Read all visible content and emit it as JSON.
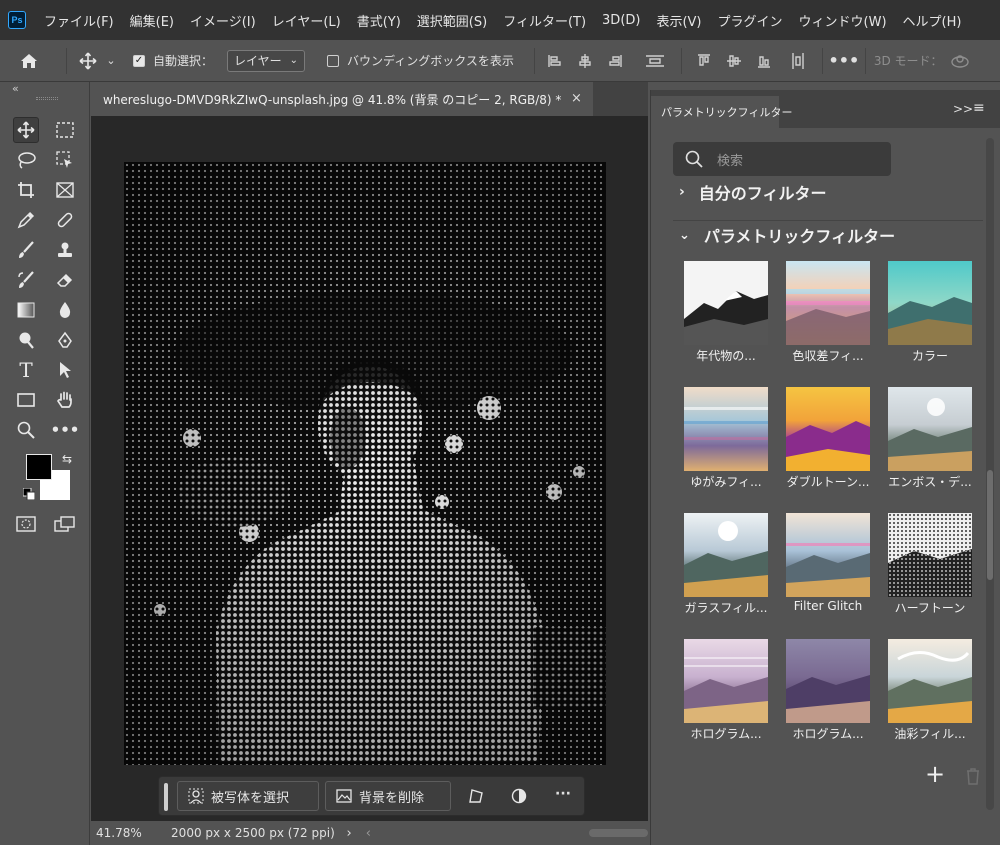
{
  "app": {
    "logo": "Ps"
  },
  "menubar": {
    "items": [
      "ファイル(F)",
      "編集(E)",
      "イメージ(I)",
      "レイヤー(L)",
      "書式(Y)",
      "選択範囲(S)",
      "フィルター(T)",
      "3D(D)",
      "表示(V)",
      "プラグイン",
      "ウィンドウ(W)",
      "ヘルプ(H)"
    ]
  },
  "options": {
    "auto_select_label": "自動選択：",
    "auto_select_checked": true,
    "target_value": "レイヤー",
    "bounding_box_label": "バウンディングボックスを表示",
    "bounding_box_checked": false,
    "mode_3d_label": "3D モード："
  },
  "toolbar": {
    "collapse": "«",
    "icons": [
      "move-tool-icon",
      "marquee-tool-icon",
      "lasso-tool-icon",
      "object-select-tool-icon",
      "crop-tool-icon",
      "frame-tool-icon",
      "eyedropper-tool-icon",
      "healing-brush-icon",
      "brush-tool-icon",
      "stamp-tool-icon",
      "history-brush-icon",
      "eraser-tool-icon",
      "gradient-tool-icon",
      "blur-tool-icon",
      "dodge-tool-icon",
      "pen-tool-icon",
      "type-tool-icon",
      "path-select-icon",
      "rectangle-tool-icon",
      "hand-tool-icon",
      "zoom-tool-icon",
      "more-tools-icon"
    ],
    "type_label": "T",
    "foreground": "#000000",
    "background": "#ffffff"
  },
  "document": {
    "tab_title": "whereslugo-DMVD9RkZIwQ-unsplash.jpg @ 41.8% (背景 のコピー 2, RGB/8) *",
    "close": "×"
  },
  "taskbar": {
    "select_subject": "被写体を選択",
    "remove_background": "背景を削除",
    "more": "···"
  },
  "status": {
    "zoom": "41.78%",
    "doc_info": "2000 px x 2500 px (72 ppi)",
    "arrow": "›",
    "left_arrow": "‹"
  },
  "panel": {
    "tab_title": "パラメトリックフィルター",
    "menu_glyphs": ">>",
    "search_placeholder": "検索",
    "my_filters": "自分のフィルター",
    "parametric_filters": "パラメトリックフィルター",
    "filters": [
      {
        "label": "年代物の..."
      },
      {
        "label": "色収差フィ..."
      },
      {
        "label": "カラー"
      },
      {
        "label": "ゆがみフィ..."
      },
      {
        "label": "ダブルトーン..."
      },
      {
        "label": "エンボス・デ..."
      },
      {
        "label": "ガラスフィル..."
      },
      {
        "label": "Filter Glitch"
      },
      {
        "label": "ハーフトーン"
      },
      {
        "label": "ホログラム..."
      },
      {
        "label": "ホログラム..."
      },
      {
        "label": "油彩フィル..."
      }
    ],
    "add": "+"
  },
  "colors": {
    "accent": "#31a8ff",
    "chrome": "#535353",
    "dark": "#323232"
  }
}
